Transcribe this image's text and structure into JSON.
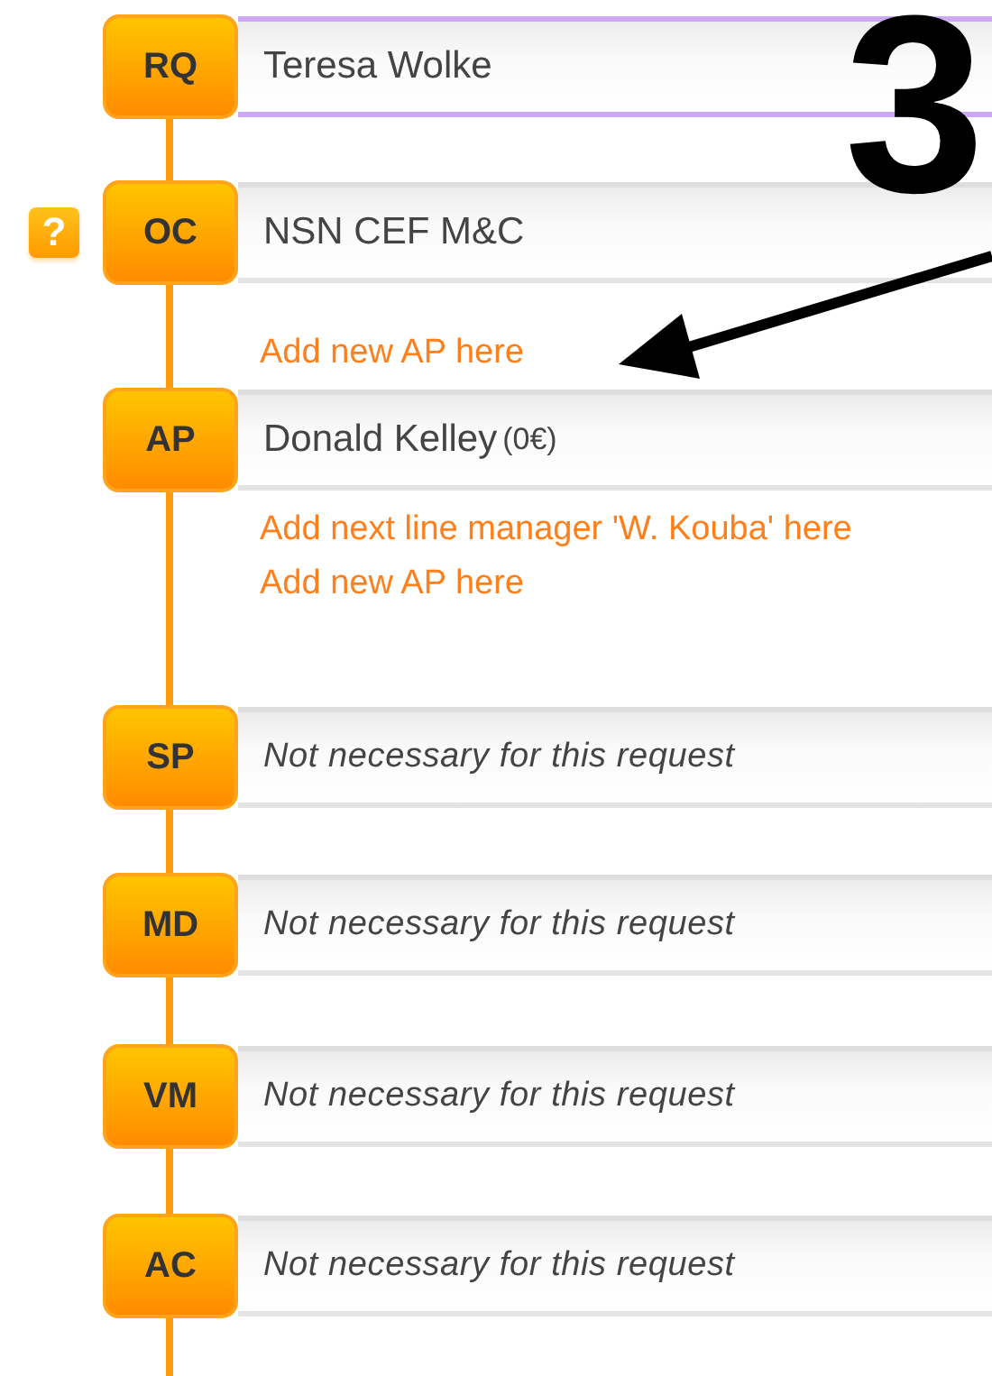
{
  "steps": [
    {
      "code": "RQ",
      "kind": "person",
      "value": "Teresa Wolke",
      "highlighted": true
    },
    {
      "code": "OC",
      "kind": "person",
      "value": "NSN CEF M&C",
      "help": "?",
      "highlighted": false,
      "links": [
        "Add new AP here"
      ]
    },
    {
      "code": "AP",
      "kind": "person",
      "value": "Donald Kelley",
      "amount": "(0€)",
      "highlighted": false,
      "links": [
        "Add next line manager 'W. Kouba' here",
        "Add new AP here"
      ]
    },
    {
      "code": "SP",
      "kind": "skipped",
      "value": "Not necessary for this request",
      "highlighted": false
    },
    {
      "code": "MD",
      "kind": "skipped",
      "value": "Not necessary for this request",
      "highlighted": false
    },
    {
      "code": "VM",
      "kind": "skipped",
      "value": "Not necessary for this request",
      "highlighted": false
    },
    {
      "code": "AC",
      "kind": "skipped",
      "value": "Not necessary for this request",
      "highlighted": false
    }
  ],
  "annotation": {
    "number": "3"
  }
}
